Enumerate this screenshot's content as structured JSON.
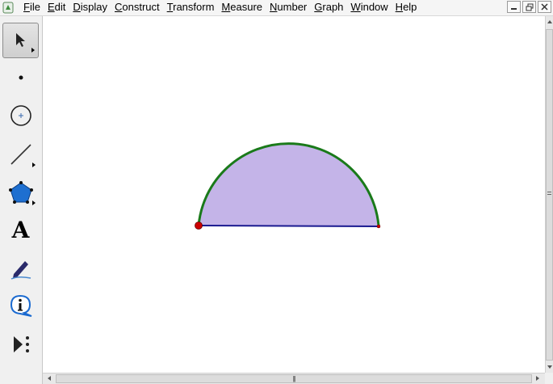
{
  "menu": {
    "items": [
      {
        "key": "F",
        "rest": "ile"
      },
      {
        "key": "E",
        "rest": "dit"
      },
      {
        "key": "D",
        "rest": "isplay"
      },
      {
        "key": "C",
        "rest": "onstruct"
      },
      {
        "key": "T",
        "rest": "ransform"
      },
      {
        "key": "M",
        "rest": "easure"
      },
      {
        "key": "N",
        "rest": "umber"
      },
      {
        "key": "G",
        "rest": "raph"
      },
      {
        "key": "W",
        "rest": "indow"
      },
      {
        "key": "H",
        "rest": "elp"
      }
    ]
  },
  "toolbox": {
    "tools": [
      {
        "name": "selection-arrow-tool",
        "icon": "arrow-pointer-icon",
        "selected": true
      },
      {
        "name": "point-tool",
        "icon": "point-icon"
      },
      {
        "name": "compass-tool",
        "icon": "circle-icon"
      },
      {
        "name": "straightedge-tool",
        "icon": "segment-icon"
      },
      {
        "name": "polygon-tool",
        "icon": "pentagon-icon"
      },
      {
        "name": "text-tool",
        "icon": "text-a-icon",
        "glyph": "A"
      },
      {
        "name": "marker-tool",
        "icon": "pen-icon"
      },
      {
        "name": "information-tool",
        "icon": "info-icon"
      },
      {
        "name": "custom-tool",
        "icon": "play-dots-icon"
      }
    ]
  },
  "colors": {
    "semicircle_fill": "#c4b4e8",
    "arc_stroke": "#1a7a1a",
    "diameter_stroke": "#1a1a90",
    "point_fill": "#cc0000"
  }
}
